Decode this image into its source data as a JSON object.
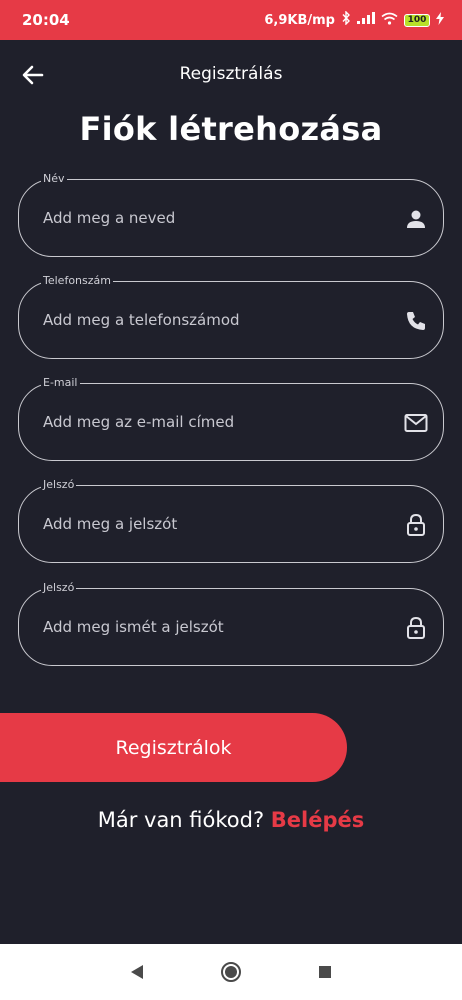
{
  "status_bar": {
    "time": "20:04",
    "network_speed": "6,9KB/mp",
    "battery": "100"
  },
  "appbar": {
    "title": "Regisztrálás",
    "back_icon": "arrow-left-icon"
  },
  "page": {
    "title": "Fiók létrehozása"
  },
  "form": {
    "fields": [
      {
        "label": "Név",
        "placeholder": "Add meg a neved",
        "icon": "person-icon"
      },
      {
        "label": "Telefonszám",
        "placeholder": "Add meg a telefonszámod",
        "icon": "phone-icon"
      },
      {
        "label": "E-mail",
        "placeholder": "Add meg az e-mail címed",
        "icon": "mail-icon"
      },
      {
        "label": "Jelszó",
        "placeholder": "Add meg a jelszót",
        "icon": "lock-icon"
      },
      {
        "label": "Jelszó",
        "placeholder": "Add meg ismét a jelszót",
        "icon": "lock-icon"
      }
    ],
    "submit_label": "Regisztrálok"
  },
  "login_prompt": {
    "text": "Már van fiókod?",
    "link": "Belépés"
  },
  "colors": {
    "accent": "#e63a46",
    "background": "#1f202b"
  }
}
